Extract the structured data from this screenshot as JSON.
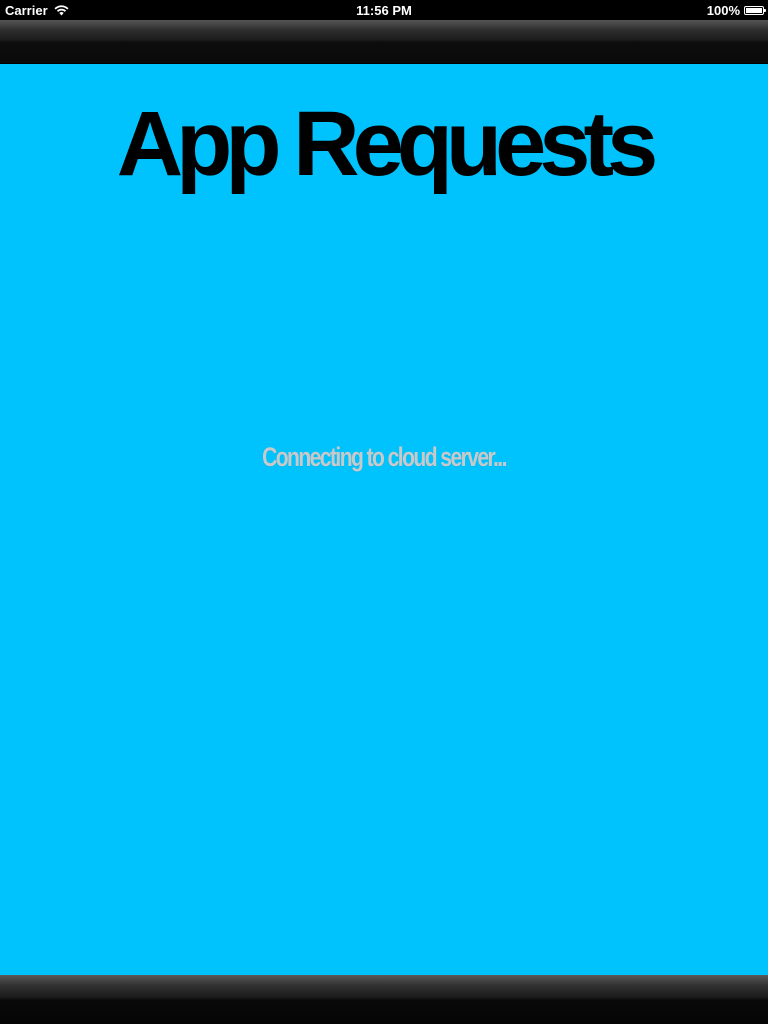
{
  "status_bar": {
    "carrier": "Carrier",
    "time": "11:56 PM",
    "battery": "100%",
    "battery_level": 1.0,
    "icons": [
      "wifi-icon",
      "battery-icon"
    ]
  },
  "content": {
    "title": "App Requests",
    "loading_text": "Connecting to cloud server..."
  },
  "colors": {
    "content_background": "#00c2fd",
    "title_text": "#000000",
    "loading_text": "#c9c9c9",
    "bars": "#1b1b1b"
  }
}
